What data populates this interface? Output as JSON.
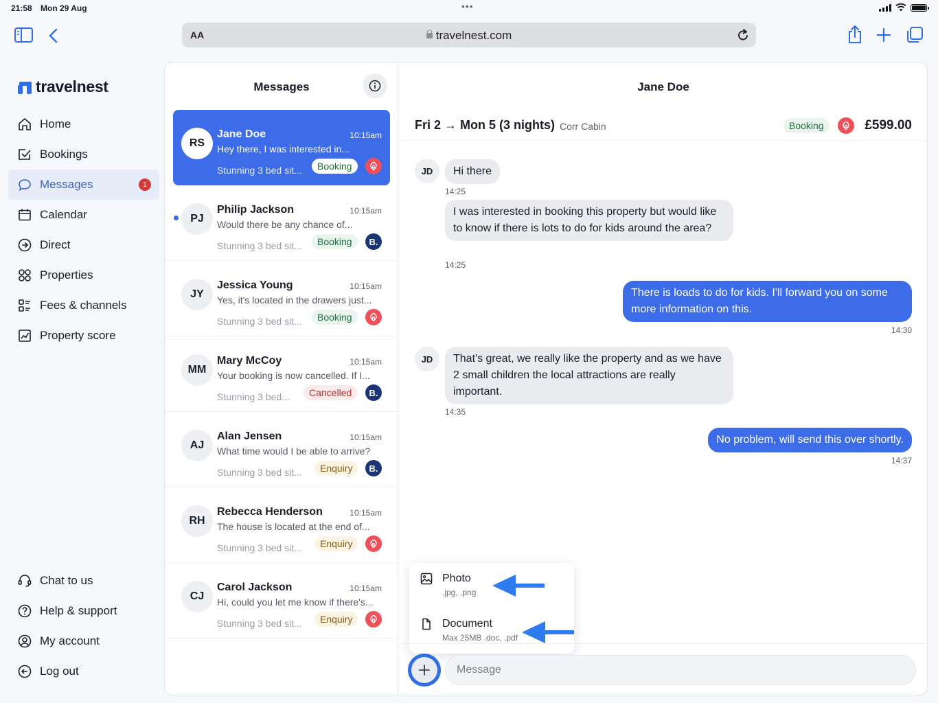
{
  "status": {
    "time": "21:58",
    "date": "Mon 29 Aug"
  },
  "browser": {
    "aa": "AA",
    "url": "travelnest.com"
  },
  "app": {
    "name": "travelnest"
  },
  "nav": [
    {
      "label": "Home",
      "icon": "home-icon"
    },
    {
      "label": "Bookings",
      "icon": "bookings-icon"
    },
    {
      "label": "Messages",
      "icon": "messages-icon",
      "badge": "1",
      "active": true
    },
    {
      "label": "Calendar",
      "icon": "calendar-icon"
    },
    {
      "label": "Direct",
      "icon": "direct-icon"
    },
    {
      "label": "Properties",
      "icon": "properties-icon"
    },
    {
      "label": "Fees & channels",
      "icon": "fees-icon"
    },
    {
      "label": "Property score",
      "icon": "score-icon"
    }
  ],
  "nav_bottom": [
    {
      "label": "Chat to us",
      "icon": "headset-icon"
    },
    {
      "label": "Help & support",
      "icon": "help-icon"
    },
    {
      "label": "My account",
      "icon": "account-icon"
    },
    {
      "label": "Log out",
      "icon": "logout-icon"
    }
  ],
  "messages_panel": {
    "title": "Messages",
    "conversations": [
      {
        "initials": "RS",
        "name": "Jane Doe",
        "time": "10:15am",
        "preview": "Hey there, I was interested in...",
        "property": "Stunning 3 bed sit...",
        "status": "Booking",
        "status_type": "booking",
        "channel": "airbnb",
        "selected": true,
        "unread": false
      },
      {
        "initials": "PJ",
        "name": "Philip Jackson",
        "time": "10:15am",
        "preview": "Would there be any chance of...",
        "property": "Stunning 3 bed sit...",
        "status": "Booking",
        "status_type": "booking",
        "channel": "bcom",
        "selected": false,
        "unread": true
      },
      {
        "initials": "JY",
        "name": "Jessica Young",
        "time": "10:15am",
        "preview": "Yes, it's located in the drawers just...",
        "property": "Stunning 3 bed sit...",
        "status": "Booking",
        "status_type": "booking",
        "channel": "airbnb",
        "selected": false,
        "unread": false
      },
      {
        "initials": "MM",
        "name": "Mary McCoy",
        "time": "10:15am",
        "preview": "Your booking is now cancelled. If I...",
        "property": "Stunning 3 bed...",
        "status": "Cancelled",
        "status_type": "cancelled",
        "channel": "bcom",
        "selected": false,
        "unread": false
      },
      {
        "initials": "AJ",
        "name": "Alan Jensen",
        "time": "10:15am",
        "preview": "What time would I be able to arrive?",
        "property": "Stunning 3 bed sit...",
        "status": "Enquiry",
        "status_type": "enquiry",
        "channel": "bcom",
        "selected": false,
        "unread": false
      },
      {
        "initials": "RH",
        "name": "Rebecca Henderson",
        "time": "10:15am",
        "preview": "The house is located at the end of...",
        "property": "Stunning 3 bed sit...",
        "status": "Enquiry",
        "status_type": "enquiry",
        "channel": "airbnb",
        "selected": false,
        "unread": false
      },
      {
        "initials": "CJ",
        "name": "Carol Jackson",
        "time": "10:15am",
        "preview": "Hi, could you let me know if there's...",
        "property": "Stunning 3 bed sit...",
        "status": "Enquiry",
        "status_type": "enquiry",
        "channel": "airbnb",
        "selected": false,
        "unread": false
      }
    ]
  },
  "chat": {
    "title": "Jane Doe",
    "dates": "Fri 2 → Mon 5 (3 nights)",
    "property": "Corr Cabin",
    "status": "Booking",
    "price": "£599.00",
    "guest_initials": "JD",
    "messages": [
      {
        "dir": "in",
        "text": "Hi there",
        "time": "14:25"
      },
      {
        "dir": "in",
        "text": "I was interested in booking this property but would like to know if there is lots to do for kids around the area?",
        "time": "14:25"
      },
      {
        "dir": "out",
        "text": "There is loads to do for kids. I'll forward you on some more information on this.",
        "time": "14:30"
      },
      {
        "dir": "in",
        "text": "That's great, we really like the property and as we have 2 small children the local attractions are really important.",
        "time": "14:35"
      },
      {
        "dir": "out",
        "text": "No problem, will send this over shortly.",
        "time": "14:37"
      }
    ],
    "attach": {
      "photo_label": "Photo",
      "photo_hint": ".jpg, .png",
      "document_label": "Document",
      "document_hint": "Max 25MB .doc, .pdf"
    },
    "input_placeholder": "Message"
  },
  "colors": {
    "accent": "#3d6ce8",
    "airbnb": "#f0505a",
    "bcom": "#1a3478",
    "badge": "#d23b3b"
  }
}
